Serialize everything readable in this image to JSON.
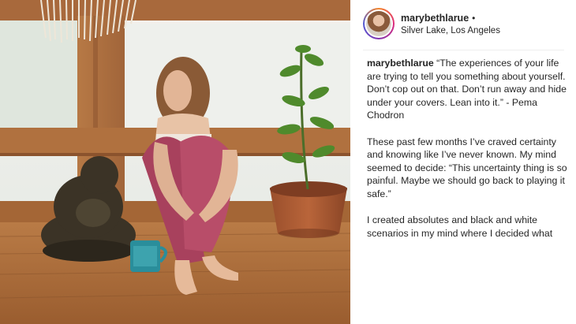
{
  "post": {
    "username": "marybethlarue",
    "separator": "•",
    "location": "Silver Lake, Los Angeles",
    "caption_username": "marybethlarue",
    "paragraphs": [
      "“The experiences of your life are trying to tell you something about yourself. Don’t cop out on that. Don’t run away and hide under your covers. Lean into it.” - Pema Chodron",
      "These past few months I’ve craved certainty and knowing like I’ve never known. My mind seemed to decide: “This uncertainty thing is so painful. Maybe we should go back to playing it safe.”",
      "I created absolutes and black and white scenarios in my mind where I decided what"
    ]
  },
  "icons": {
    "avatar": "profile-avatar-icon"
  },
  "colors": {
    "text": "#262626",
    "divider": "#efefef",
    "background": "#ffffff"
  }
}
